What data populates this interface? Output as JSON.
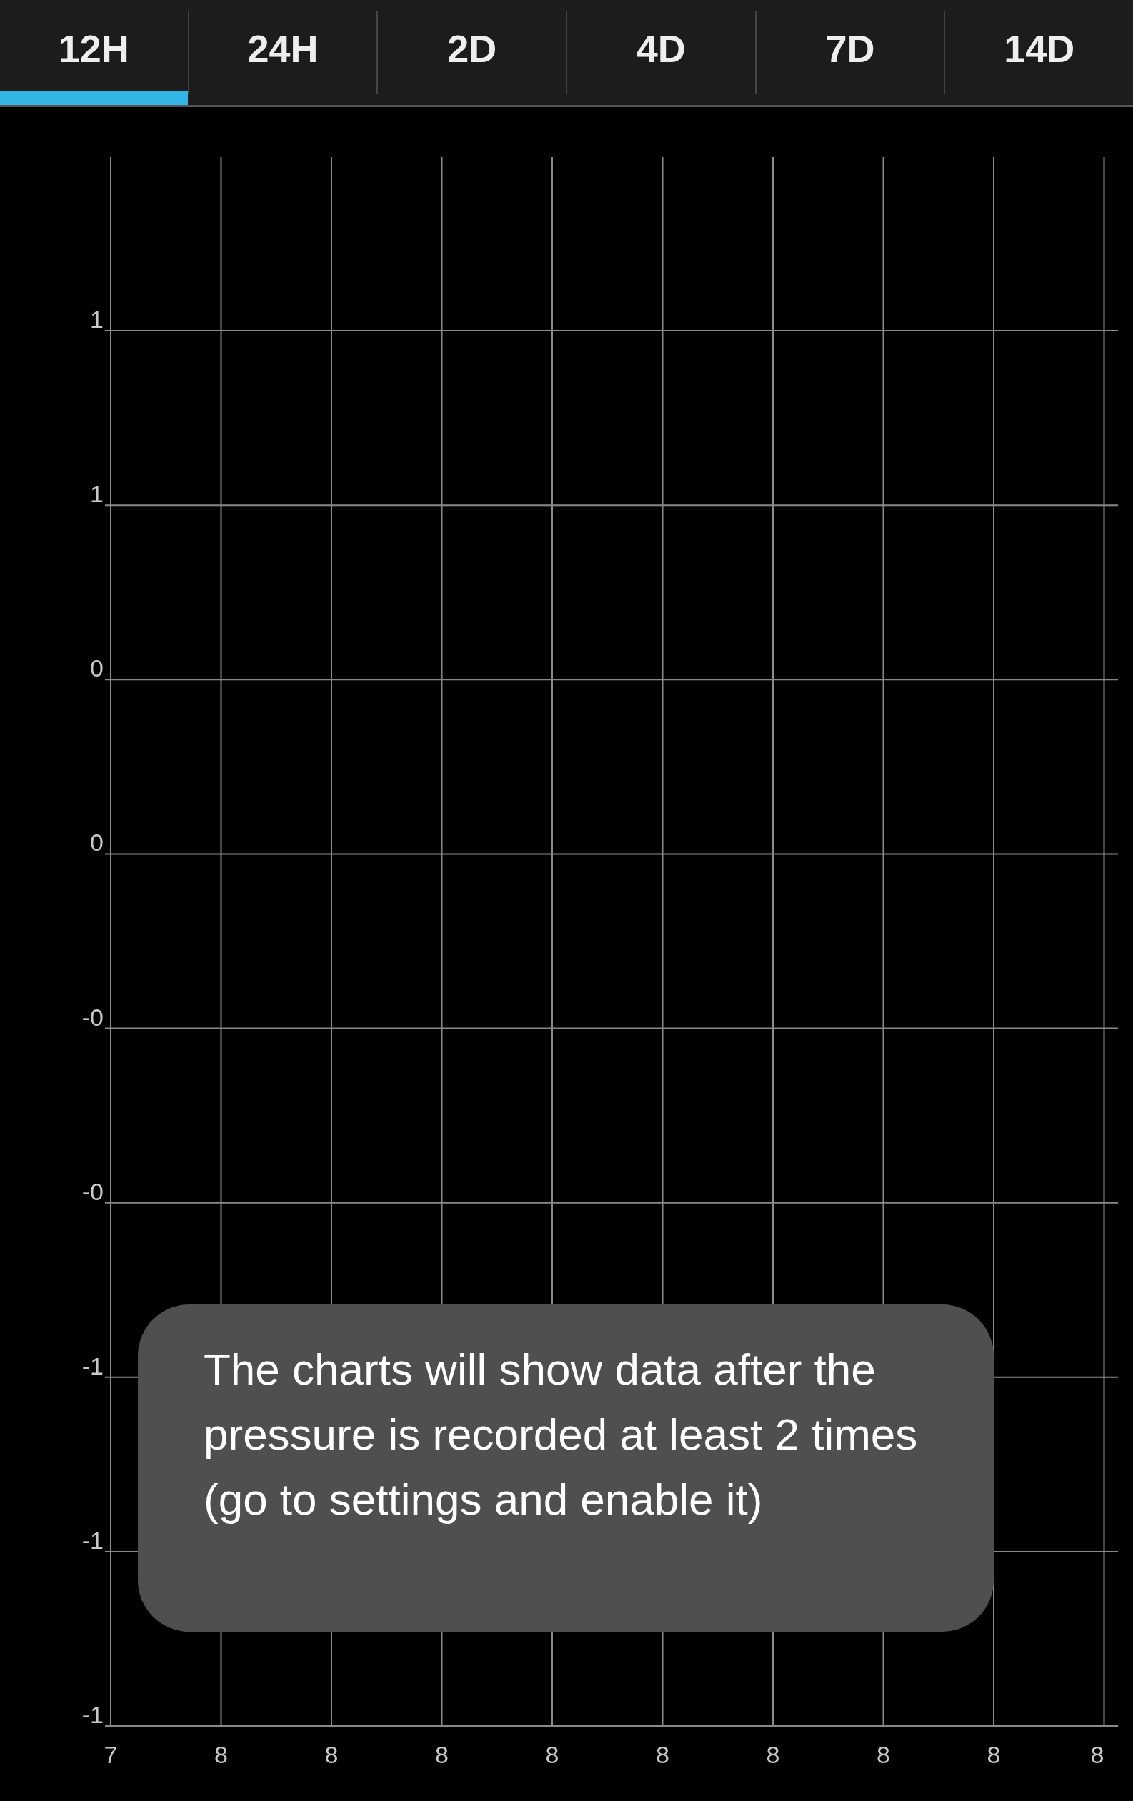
{
  "tabs": [
    {
      "label": "12H",
      "selected": true
    },
    {
      "label": "24H",
      "selected": false
    },
    {
      "label": "2D",
      "selected": false
    },
    {
      "label": "4D",
      "selected": false
    },
    {
      "label": "7D",
      "selected": false
    },
    {
      "label": "14D",
      "selected": false
    }
  ],
  "chart": {
    "y_axis_labels": [
      "1",
      "1",
      "0",
      "0",
      "-0",
      "-0",
      "-1",
      "-1",
      "-1"
    ],
    "x_axis_labels": [
      "7",
      "8",
      "8",
      "8",
      "8",
      "8",
      "8",
      "8",
      "8",
      "8"
    ]
  },
  "toast": {
    "message": "The charts will show data after the pressure is recorded at least 2 times (go to settings and enable it)"
  }
}
